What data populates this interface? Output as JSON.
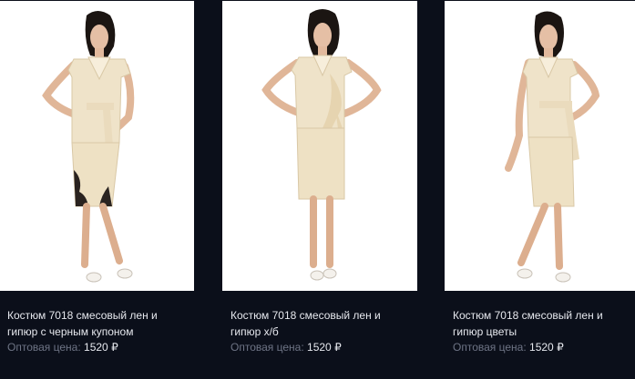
{
  "products": [
    {
      "title": "Костюм 7018 смесовый лен и гипюр с черным купоном",
      "price_label": "Оптовая цена:",
      "price": "1520",
      "currency": "₽"
    },
    {
      "title": "Костюм 7018 смесовый лен и гипюр х/б",
      "price_label": "Оптовая цена:",
      "price": "1520",
      "currency": "₽"
    },
    {
      "title": "Костюм 7018 смесовый лен и гипюр цветы",
      "price_label": "Оптовая цена:",
      "price": "1520",
      "currency": "₽"
    }
  ],
  "colors": {
    "page_background": "#0b0f1a",
    "title_text": "#e6e8ee",
    "label_text": "#6e7485",
    "garment": "#efe3c9"
  }
}
